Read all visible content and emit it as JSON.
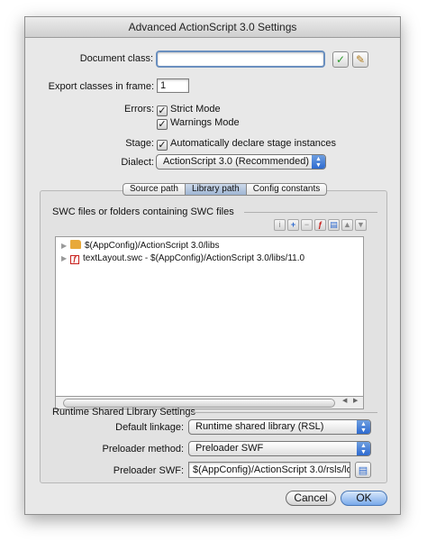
{
  "window": {
    "title": "Advanced ActionScript 3.0 Settings"
  },
  "document_class": {
    "label": "Document class:",
    "value": ""
  },
  "export_frame": {
    "label": "Export classes in frame:",
    "value": "1"
  },
  "errors": {
    "label": "Errors:",
    "strict_mode": "Strict Mode",
    "warnings_mode": "Warnings Mode"
  },
  "stage": {
    "label": "Stage:",
    "auto_declare": "Automatically declare stage instances"
  },
  "dialect": {
    "label": "Dialect:",
    "value": "ActionScript 3.0 (Recommended)"
  },
  "tabs": [
    {
      "label": "Source path"
    },
    {
      "label": "Library path"
    },
    {
      "label": "Config constants"
    }
  ],
  "swc": {
    "heading": "SWC files or folders containing SWC files",
    "items": [
      {
        "text": "$(AppConfig)/ActionScript 3.0/libs"
      },
      {
        "text": "textLayout.swc - $(AppConfig)/ActionScript 3.0/libs/11.0"
      }
    ]
  },
  "rsl": {
    "heading": "Runtime Shared Library Settings",
    "default_linkage": {
      "label": "Default linkage:",
      "value": "Runtime shared library (RSL)"
    },
    "preloader_method": {
      "label": "Preloader method:",
      "value": "Preloader SWF"
    },
    "preloader_swf": {
      "label": "Preloader SWF:",
      "value": "$(AppConfig)/ActionScript 3.0/rsls/lo"
    }
  },
  "buttons": {
    "cancel": "Cancel",
    "ok": "OK"
  },
  "colors": {
    "accent": "#2d6ad0",
    "check_green": "#2a9a2a",
    "folder": "#e8a93a",
    "swc_red": "#c8201c"
  }
}
